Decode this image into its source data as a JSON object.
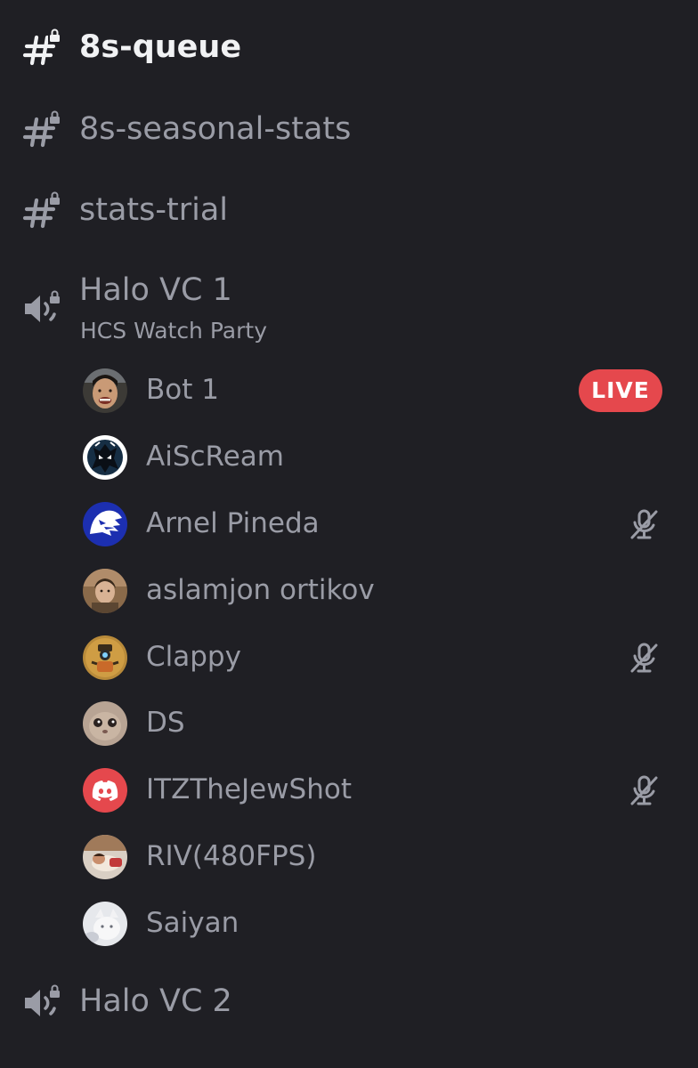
{
  "text_channels": [
    {
      "name": "8s-queue",
      "icon": "locked-hashtag-icon",
      "active": true
    },
    {
      "name": "8s-seasonal-stats",
      "icon": "locked-hashtag-icon",
      "active": false
    },
    {
      "name": "stats-trial",
      "icon": "locked-hashtag-icon",
      "active": false
    }
  ],
  "voice_channels": [
    {
      "name": "Halo VC 1",
      "status": "HCS Watch Party",
      "icon": "locked-speaker-icon",
      "members": [
        {
          "name": "Bot 1",
          "badge": "LIVE",
          "muted": false
        },
        {
          "name": "AiScReam",
          "muted": false
        },
        {
          "name": "Arnel Pineda",
          "muted": true
        },
        {
          "name": "aslamjon ortikov",
          "muted": false
        },
        {
          "name": "Clappy",
          "muted": true
        },
        {
          "name": "DS",
          "muted": false
        },
        {
          "name": "ITZTheJewShot",
          "muted": true
        },
        {
          "name": "RIV(480FPS)",
          "muted": false
        },
        {
          "name": "Saiyan",
          "muted": false
        }
      ]
    },
    {
      "name": "Halo VC 2",
      "icon": "locked-speaker-icon"
    }
  ],
  "colors": {
    "background": "#1f1f24",
    "text_muted": "#9a9ca6",
    "text_active": "#f1f2f4",
    "live_badge": "#e5484d",
    "discord_avatar": "#e5484d"
  }
}
